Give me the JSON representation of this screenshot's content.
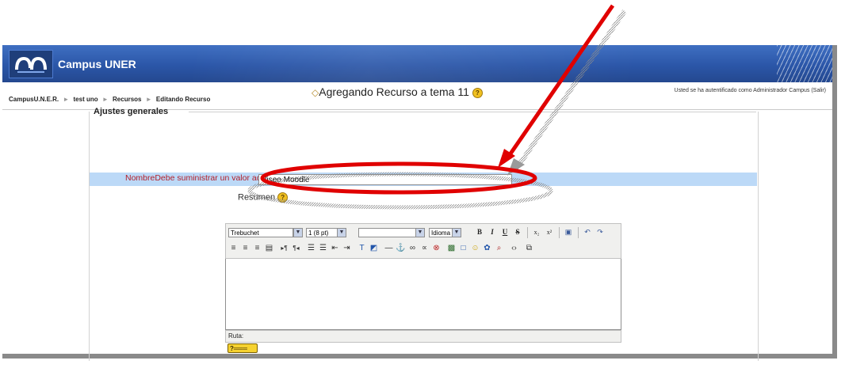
{
  "header": {
    "site_name": "Campus UNER"
  },
  "navbar": {
    "breadcrumb": [
      "CampusU.N.E.R.",
      "test uno",
      "Recursos",
      "Editando Recurso"
    ],
    "separator": "►",
    "login_text": "Usted se ha autentificado como",
    "login_user": "Administrador Campus",
    "logout_label": "(Salir)"
  },
  "page": {
    "title": "Agregando Recurso a tema 11",
    "help_glyph": "?"
  },
  "form": {
    "fieldset_legend": "Ajustes generales",
    "name_label": "NombreDebe suministrar un valor aquí",
    "name_value": "Viseo Moodle",
    "summary_label": "Resumen"
  },
  "editor": {
    "font_family": "Trebuchet",
    "font_size": "1 (8 pt)",
    "format": "",
    "language": "Idioma",
    "btn_bold": "B",
    "btn_italic": "I",
    "btn_underline": "U",
    "btn_strike": "S",
    "path_label": "Ruta:"
  },
  "colors": {
    "banner": "#2b56a8",
    "highlight_row": "#bcd9f7",
    "required_label": "#b2202a",
    "arrow_red": "#e00000"
  }
}
